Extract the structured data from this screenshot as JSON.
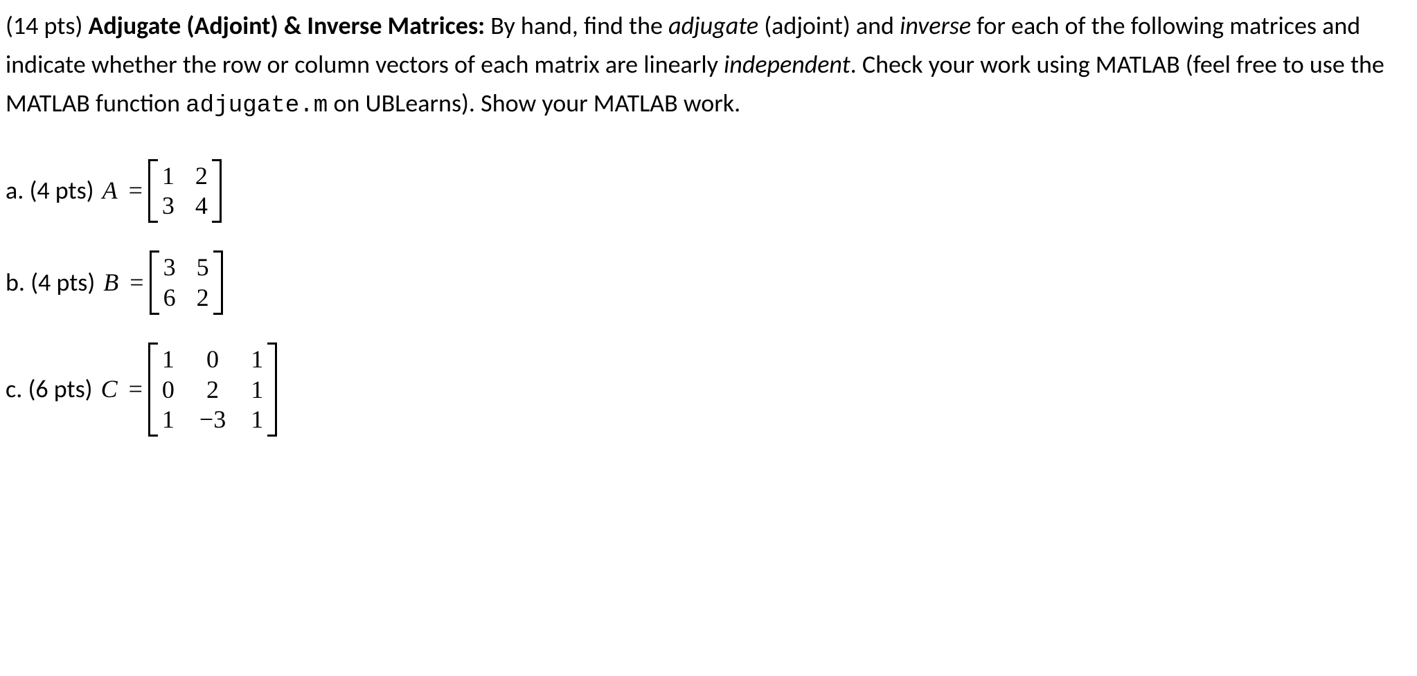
{
  "prompt": {
    "points": "(14 pts) ",
    "title_bold": "Adjugate (Adjoint) & Inverse Matrices:",
    "sep": "   ",
    "t1": "By hand, find the ",
    "adjugate_italic": "adjugate",
    "t2": " (adjoint) and ",
    "inverse_italic": "inverse",
    "t3": " for each of the following matrices and indicate whether the row or column vectors of each matrix are linearly ",
    "independent_italic": "independent",
    "t4": ". Check your work using MATLAB (feel free to use the MATLAB function ",
    "code": "adjugate.m",
    "t5": "  on UBLearns). Show your MATLAB work."
  },
  "problems": {
    "a": {
      "label": "a. (4 pts)  ",
      "var": "A",
      "eq": "=",
      "matrix": [
        [
          "1",
          "2"
        ],
        [
          "3",
          "4"
        ]
      ]
    },
    "b": {
      "label": "b. (4 pts)  ",
      "var": "B",
      "eq": "=",
      "matrix": [
        [
          "3",
          "5"
        ],
        [
          "6",
          "2"
        ]
      ]
    },
    "c": {
      "label": "c. (6 pts)  ",
      "var": "C",
      "eq": "=",
      "matrix": [
        [
          "1",
          "0",
          "1"
        ],
        [
          "0",
          "2",
          "1"
        ],
        [
          "1",
          "−3",
          "1"
        ]
      ]
    }
  }
}
